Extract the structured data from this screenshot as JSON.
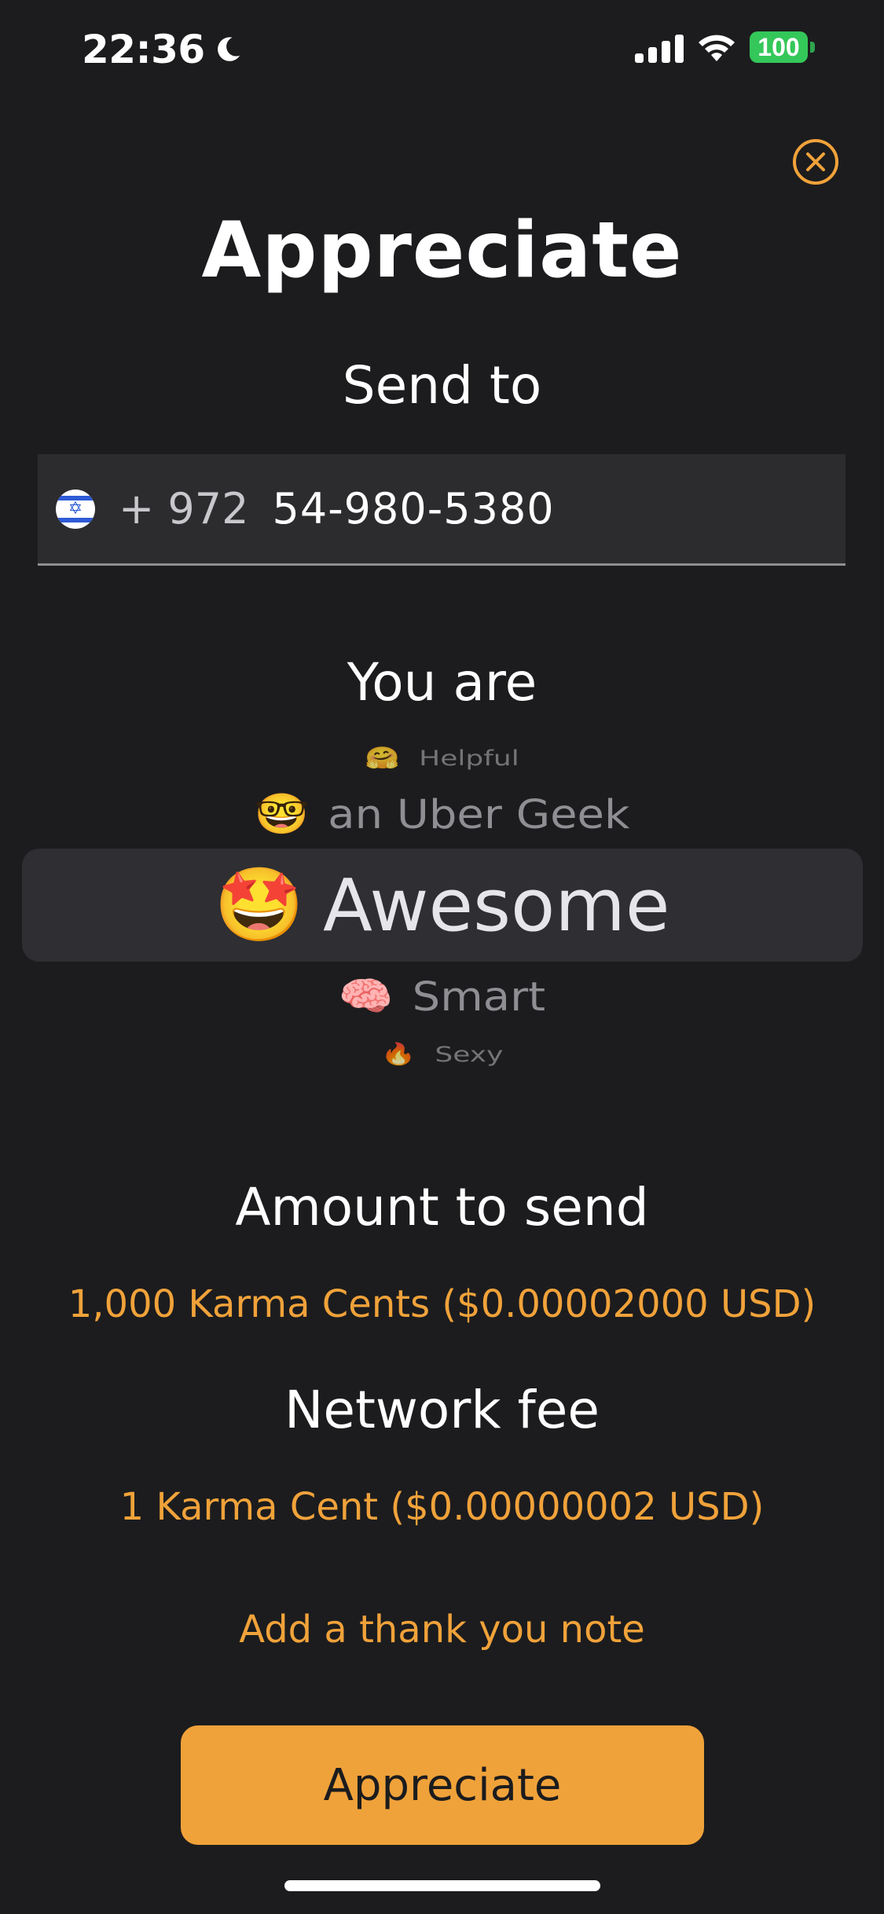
{
  "status_bar": {
    "time": "22:36",
    "battery_level": "100",
    "icons": [
      "moon-icon",
      "cellular-signal-icon",
      "wifi-icon",
      "battery-icon"
    ]
  },
  "header": {
    "close_icon": "close-circle-icon",
    "title": "Appreciate"
  },
  "recipient": {
    "label": "Send to",
    "flag_icon": "israel-flag-icon",
    "country_code": "+ 972",
    "phone_number": "54-980-5380"
  },
  "compliment": {
    "label": "You are",
    "options": [
      {
        "emoji": "🤗",
        "label": "Helpful"
      },
      {
        "emoji": "🤓",
        "label": "an Uber Geek"
      },
      {
        "emoji": "🤩",
        "label": "Awesome"
      },
      {
        "emoji": "🧠",
        "label": "Smart"
      },
      {
        "emoji": "🔥",
        "label": "Sexy"
      }
    ],
    "selected": "Awesome"
  },
  "amount": {
    "label": "Amount to send",
    "value": "1,000 Karma Cents ($0.00002000 USD)"
  },
  "fee": {
    "label": "Network fee",
    "value": "1 Karma Cent ($0.00000002 USD)"
  },
  "note_link": "Add a thank you note",
  "submit_label": "Appreciate",
  "colors": {
    "background": "#1c1c1e",
    "accent": "#f0a23a",
    "field": "#2c2c2e",
    "battery": "#34c759"
  }
}
